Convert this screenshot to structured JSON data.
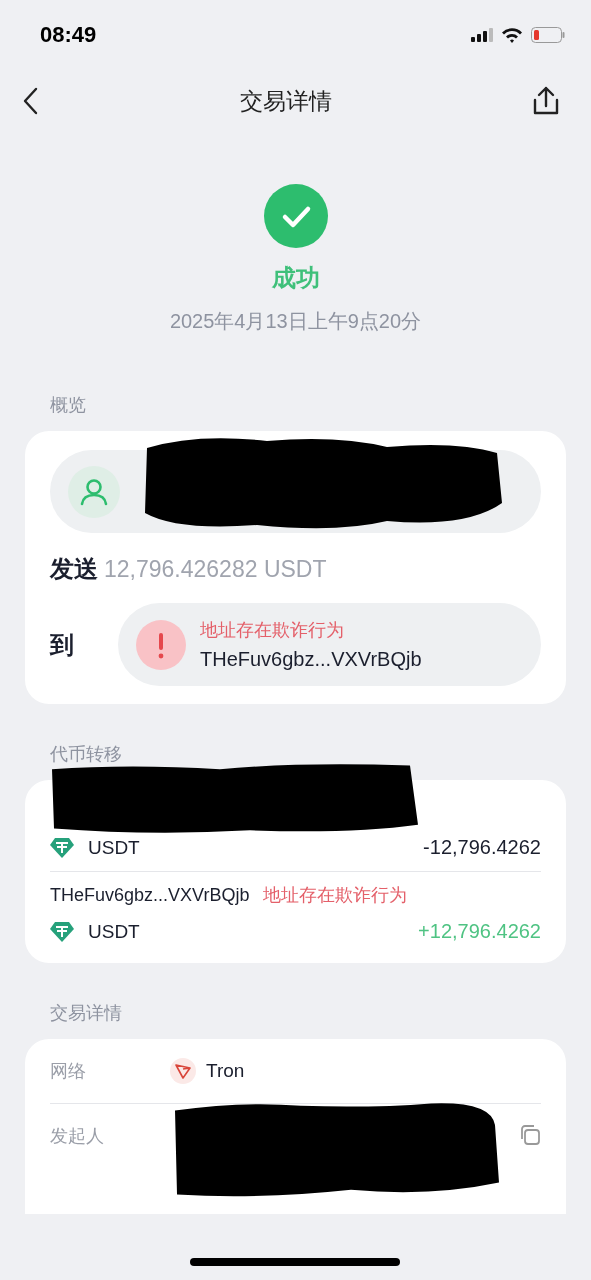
{
  "status_bar": {
    "time": "08:49"
  },
  "nav": {
    "title": "交易详情"
  },
  "result": {
    "kind": "success",
    "text": "成功",
    "date": "2025年4月13日上午9点20分"
  },
  "overview": {
    "label": "概览",
    "send_label": "发送",
    "send_amount": "12,796.426282 USDT",
    "to_label": "到",
    "to_warning": "地址存在欺诈行为",
    "to_address": "THeFuv6gbz...VXVrBQjb"
  },
  "transfers": {
    "label": "代币转移",
    "items": [
      {
        "redacted": true,
        "token": "USDT",
        "amount": "-12,796.4262",
        "kind": "outgoing"
      },
      {
        "redacted": false,
        "address": "THeFuv6gbz...VXVrBQjb",
        "warning": "地址存在欺诈行为",
        "token": "USDT",
        "amount": "+12,796.4262",
        "kind": "incoming"
      }
    ]
  },
  "details": {
    "label": "交易详情",
    "rows": [
      {
        "kind": "network",
        "label": "网络",
        "value": "Tron"
      },
      {
        "kind": "copy",
        "label": "发起人"
      }
    ]
  }
}
